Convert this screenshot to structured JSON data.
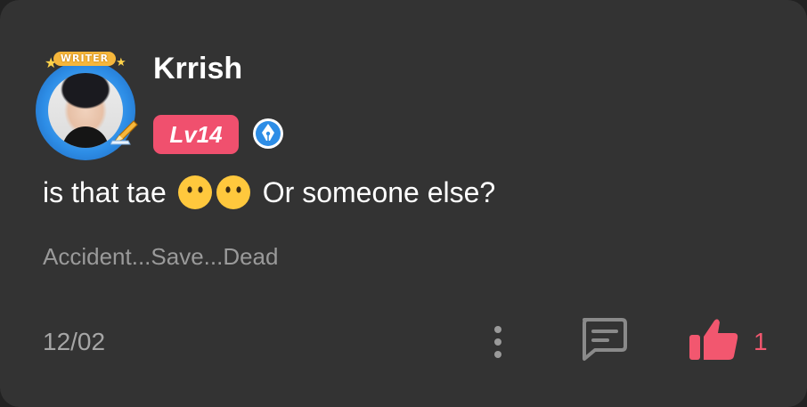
{
  "comment": {
    "author_name": "Krrish",
    "writer_label": "WRITER",
    "level": "Lv14",
    "text_prefix": "is that tae",
    "text_suffix": "Or someone else?",
    "emoji": [
      "confused-face-emoji",
      "confused-face-emoji"
    ],
    "source": "Accident...Save...Dead",
    "date": "12/02",
    "like_count": "1"
  },
  "icons": {
    "more": "more-vertical-icon",
    "reply": "comment-bubble-icon",
    "like": "thumbs-up-icon",
    "verify": "pen-nib-badge-icon"
  },
  "colors": {
    "card_bg": "#333333",
    "level_badge": "#f0506e",
    "like_accent": "#f2576f",
    "verify_blue": "#2d8de6"
  }
}
